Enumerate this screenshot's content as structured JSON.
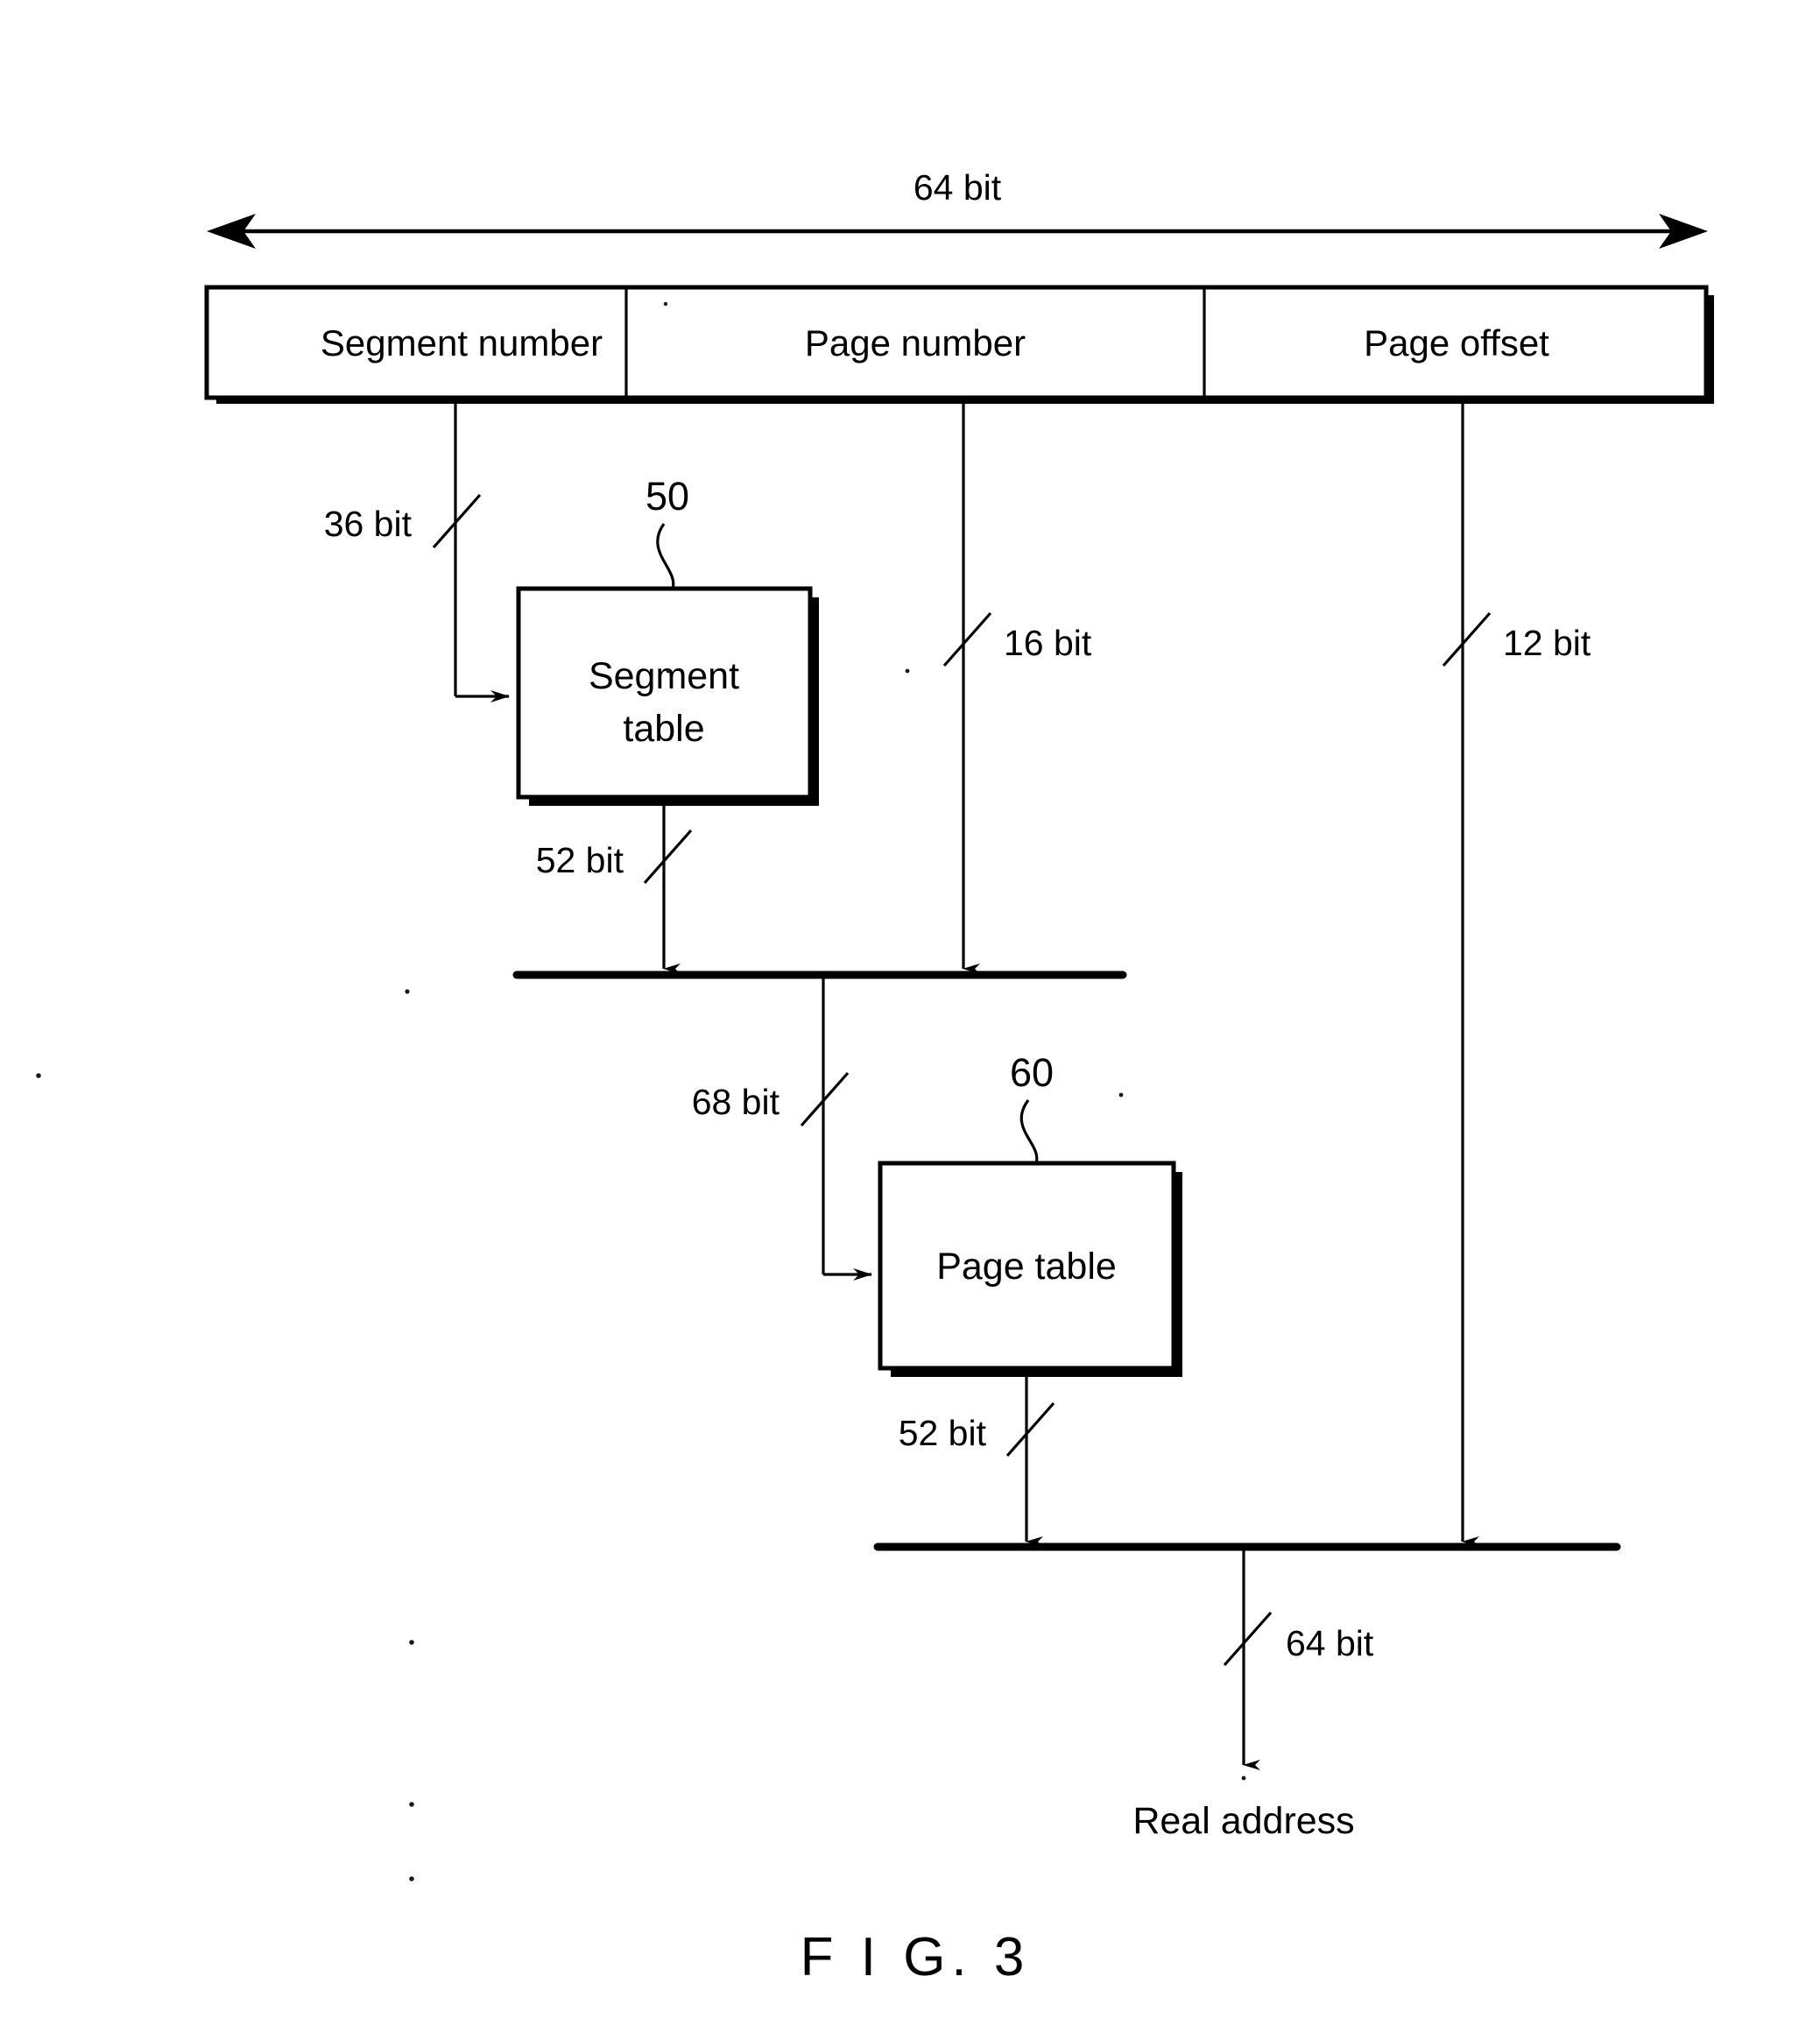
{
  "figure": {
    "caption": "F I G. 3",
    "title_width_label": "64 bit"
  },
  "address_fields": [
    {
      "id": "segment-number",
      "label": "Segment number"
    },
    {
      "id": "page-number",
      "label": "Page number"
    },
    {
      "id": "page-offset",
      "label": "Page offset"
    }
  ],
  "bit_labels": {
    "segment_index": "36 bit",
    "page_index": "16 bit",
    "page_offset": "12 bit",
    "segment_table_out": "52 bit",
    "page_table_in": "68 bit",
    "page_table_out": "52 bit",
    "real_address_out": "64 bit"
  },
  "blocks": [
    {
      "id": "segment-table",
      "line1": "Segment",
      "line2": "table",
      "ref": "50"
    },
    {
      "id": "page-table",
      "line1": "Page table",
      "line2": "",
      "ref": "60"
    }
  ],
  "outputs": {
    "real_address": "Real address"
  },
  "colors": {
    "ink": "#000000",
    "paper": "#ffffff"
  }
}
